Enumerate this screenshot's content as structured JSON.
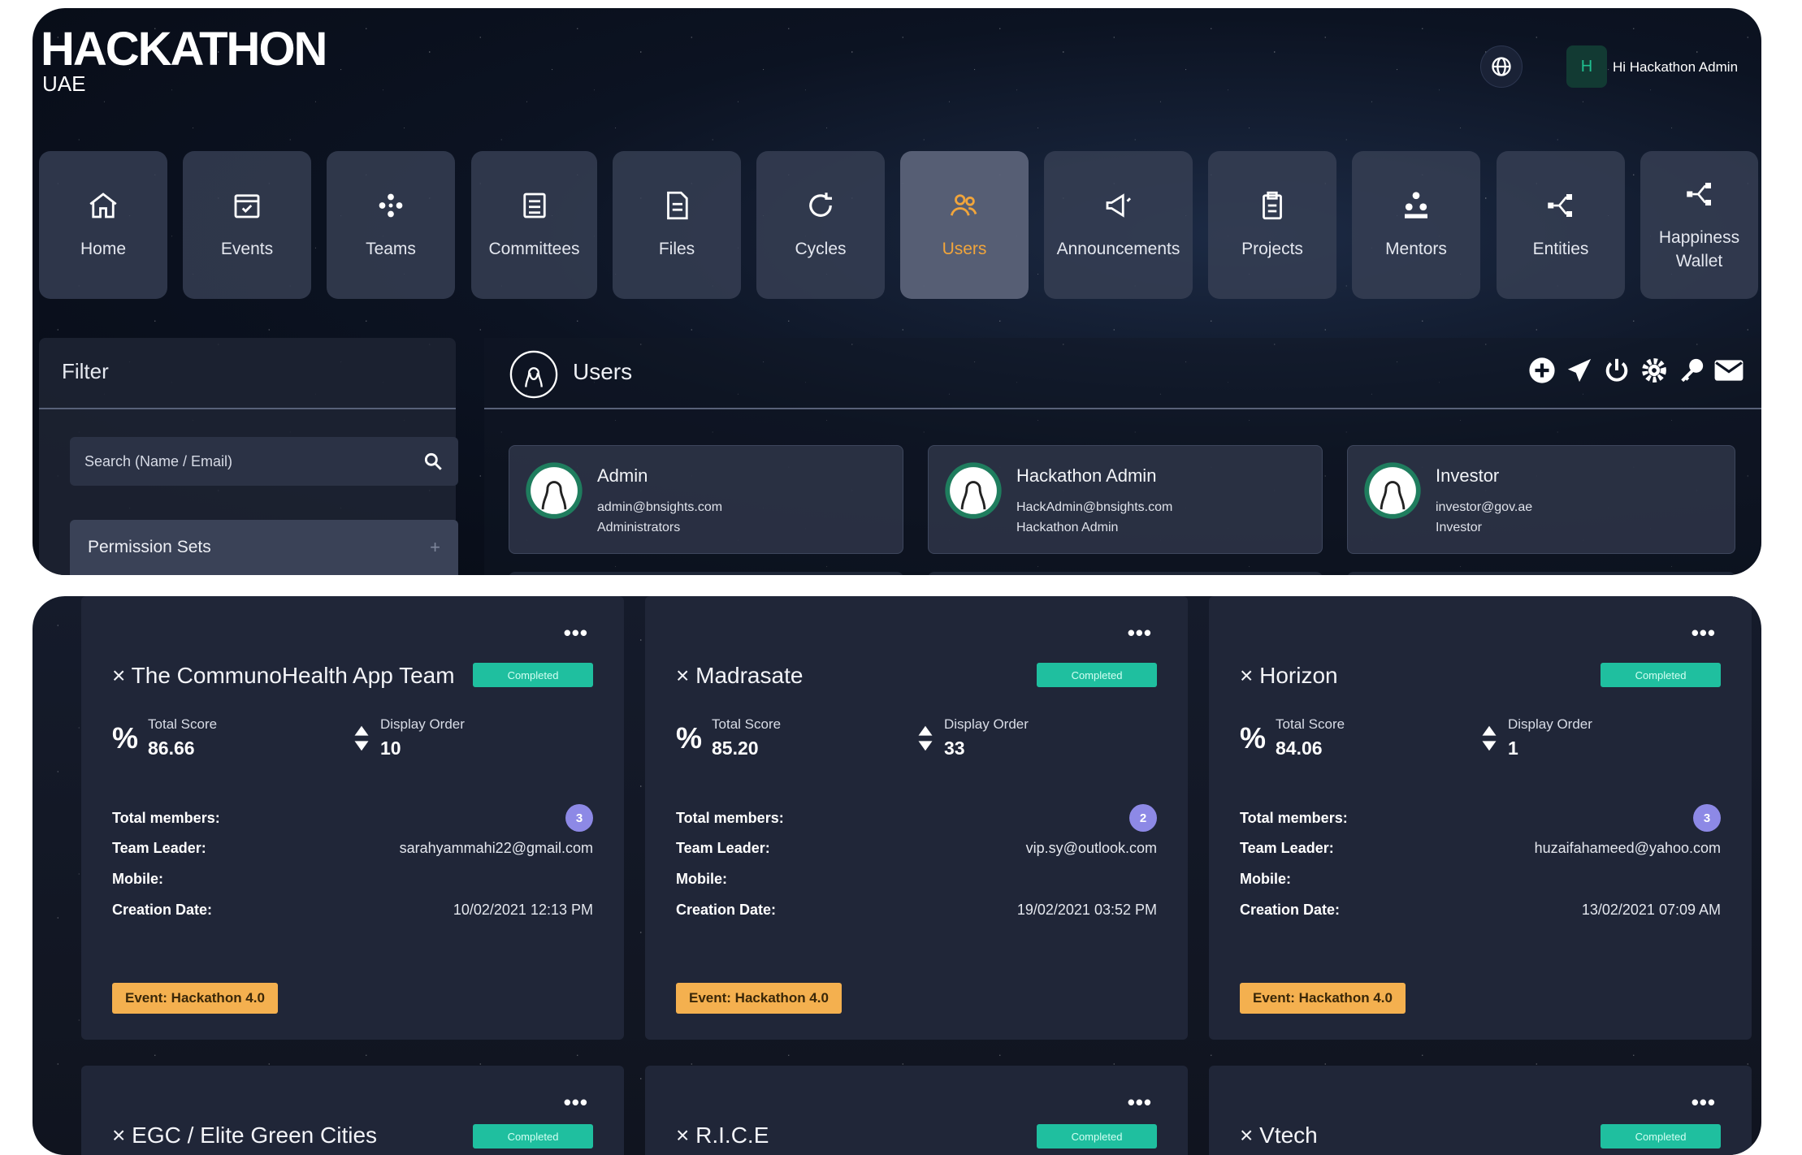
{
  "header": {
    "logo": "HACKATHON",
    "logo_sub": "UAE",
    "avatar_letter": "H",
    "greeting": "Hi Hackathon Admin"
  },
  "nav": [
    {
      "label": "Home",
      "icon": "home-icon"
    },
    {
      "label": "Events",
      "icon": "calendar-check-icon"
    },
    {
      "label": "Teams",
      "icon": "teams-icon"
    },
    {
      "label": "Committees",
      "icon": "committee-icon"
    },
    {
      "label": "Files",
      "icon": "file-icon"
    },
    {
      "label": "Cycles",
      "icon": "cycle-icon"
    },
    {
      "label": "Users",
      "icon": "users-icon",
      "active": true
    },
    {
      "label": "Announcements",
      "icon": "megaphone-icon"
    },
    {
      "label": "Projects",
      "icon": "clipboard-icon"
    },
    {
      "label": "Mentors",
      "icon": "mentors-icon"
    },
    {
      "label": "Entities",
      "icon": "share-icon"
    },
    {
      "label": "Happiness Wallet",
      "icon": "share-icon"
    }
  ],
  "filter": {
    "title": "Filter",
    "search_placeholder": "Search (Name / Email)",
    "permission_sets": "Permission Sets",
    "perm_toggle": "+"
  },
  "users_panel": {
    "title": "Users",
    "toolbar": [
      "plus-circle-icon",
      "paper-plane-icon",
      "power-icon",
      "gear-icon",
      "key-icon",
      "envelope-icon"
    ],
    "cards": [
      {
        "name": "Admin",
        "email": "admin@bnsights.com",
        "role": "Administrators"
      },
      {
        "name": "Hackathon Admin",
        "email": "HackAdmin@bnsights.com",
        "role": "Hackathon Admin"
      },
      {
        "name": "Investor",
        "email": "investor@gov.ae",
        "role": "Investor"
      }
    ]
  },
  "teams": {
    "labels": {
      "total_score": "Total Score",
      "display_order": "Display Order",
      "total_members": "Total members:",
      "team_leader": "Team Leader:",
      "mobile": "Mobile:",
      "creation_date": "Creation Date:",
      "more": "•••",
      "close": "×"
    },
    "cards": [
      {
        "name": "The CommunoHealth App Team",
        "status": "Completed",
        "score": "86.66",
        "order": "10",
        "members": "3",
        "leader": "sarahyammahi22@gmail.com",
        "mobile": "",
        "created": "10/02/2021 12:13 PM",
        "event": "Event: Hackathon 4.0"
      },
      {
        "name": "Madrasate",
        "status": "Completed",
        "score": "85.20",
        "order": "33",
        "members": "2",
        "leader": "vip.sy@outlook.com",
        "mobile": "",
        "created": "19/02/2021 03:52 PM",
        "event": "Event: Hackathon 4.0"
      },
      {
        "name": "Horizon",
        "status": "Completed",
        "score": "84.06",
        "order": "1",
        "members": "3",
        "leader": "huzaifahameed@yahoo.com",
        "mobile": "",
        "created": "13/02/2021 07:09 AM",
        "event": "Event: Hackathon 4.0"
      },
      {
        "name": "EGC / Elite Green Cities",
        "status": "Completed"
      },
      {
        "name": "R.I.C.E",
        "status": "Completed"
      },
      {
        "name": "Vtech",
        "status": "Completed"
      }
    ]
  },
  "colors": {
    "accent": "#f1a53b",
    "completed": "#1fbf9f",
    "event_badge": "#f4b04f",
    "members_badge": "#8d89e6"
  }
}
